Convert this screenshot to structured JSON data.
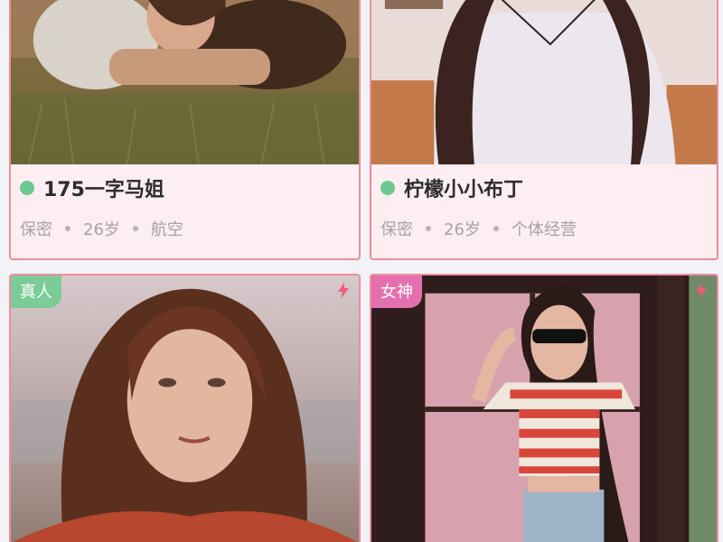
{
  "cards": [
    {
      "name": "175一字马姐",
      "status_color": "#6ec893",
      "meta": [
        "保密",
        "26岁",
        "航空"
      ]
    },
    {
      "name": "柠檬小小布丁",
      "status_color": "#6ec893",
      "meta": [
        "保密",
        "26岁",
        "个体经营"
      ]
    },
    {
      "tag": "真人",
      "tag_color": "#7ccc97",
      "icon": "lightning-icon"
    },
    {
      "tag": "女神",
      "tag_color": "#e46fae",
      "icon": "lightning-icon"
    }
  ]
}
